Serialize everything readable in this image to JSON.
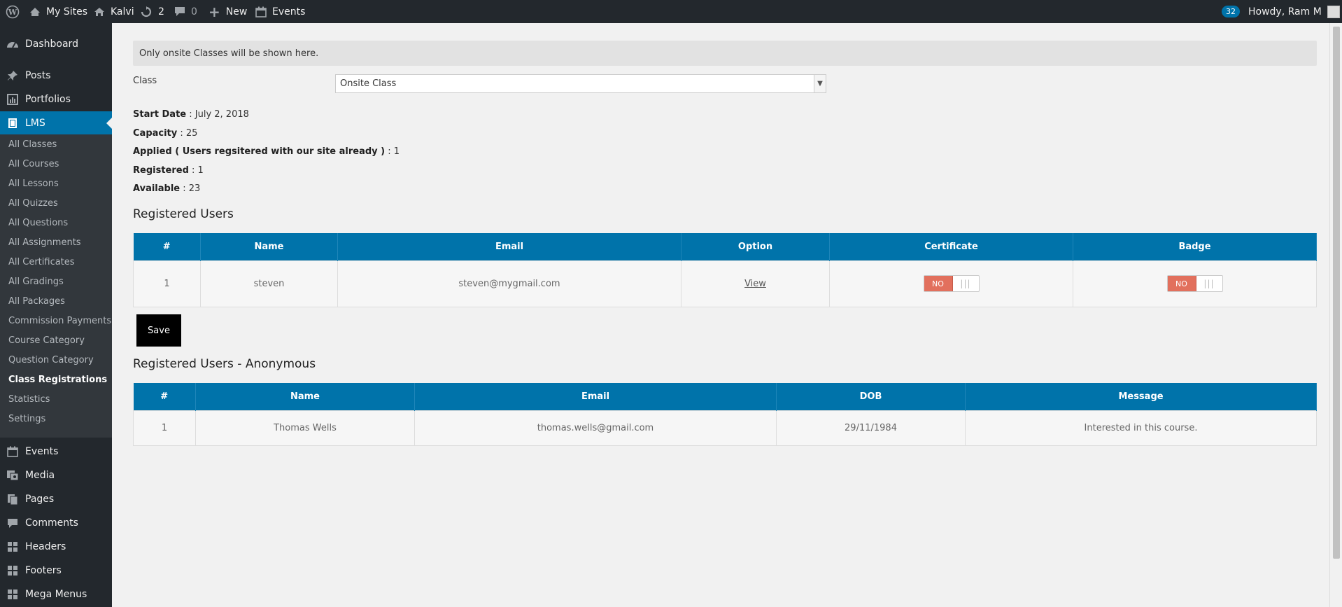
{
  "adminbar": {
    "my_sites": "My Sites",
    "site_name": "Kalvi",
    "updates_count": "2",
    "comments_count": "0",
    "new_label": "New",
    "events_label": "Events",
    "notification_count": "32",
    "howdy": "Howdy, Ram M"
  },
  "sidebar": {
    "dashboard": "Dashboard",
    "posts": "Posts",
    "portfolios": "Portfolios",
    "lms": "LMS",
    "submenu": [
      "All Classes",
      "All Courses",
      "All Lessons",
      "All Quizzes",
      "All Questions",
      "All Assignments",
      "All Certificates",
      "All Gradings",
      "All Packages",
      "Commission Payments",
      "Course Category",
      "Question Category",
      "Class Registrations",
      "Statistics",
      "Settings"
    ],
    "events": "Events",
    "media": "Media",
    "pages": "Pages",
    "comments": "Comments",
    "headers": "Headers",
    "footers": "Footers",
    "mega_menus": "Mega Menus"
  },
  "main": {
    "notice": "Only onsite Classes will be shown here.",
    "class_label": "Class",
    "class_selected": "Onsite Class",
    "start_date_label": "Start Date",
    "start_date_value": " : July 2, 2018",
    "capacity_label": "Capacity",
    "capacity_value": " : 25",
    "applied_label": "Applied ( Users regsitered with our site already )",
    "applied_value": " : 1",
    "registered_label": "Registered",
    "registered_value": " : 1",
    "available_label": "Available",
    "available_value": " : 23",
    "registered_users_title": "Registered Users",
    "registered_headers": [
      "#",
      "Name",
      "Email",
      "Option",
      "Certificate",
      "Badge"
    ],
    "registered_rows": [
      {
        "num": "1",
        "name": "steven",
        "email": "steven@mygmail.com",
        "option": "View",
        "certificate": "NO",
        "badge": "NO"
      }
    ],
    "save_label": "Save",
    "anonymous_title": "Registered Users - Anonymous",
    "anonymous_headers": [
      "#",
      "Name",
      "Email",
      "DOB",
      "Message"
    ],
    "anonymous_rows": [
      {
        "num": "1",
        "name": "Thomas Wells",
        "email": "thomas.wells@gmail.com",
        "dob": "29/11/1984",
        "message": "Interested in this course."
      }
    ]
  }
}
